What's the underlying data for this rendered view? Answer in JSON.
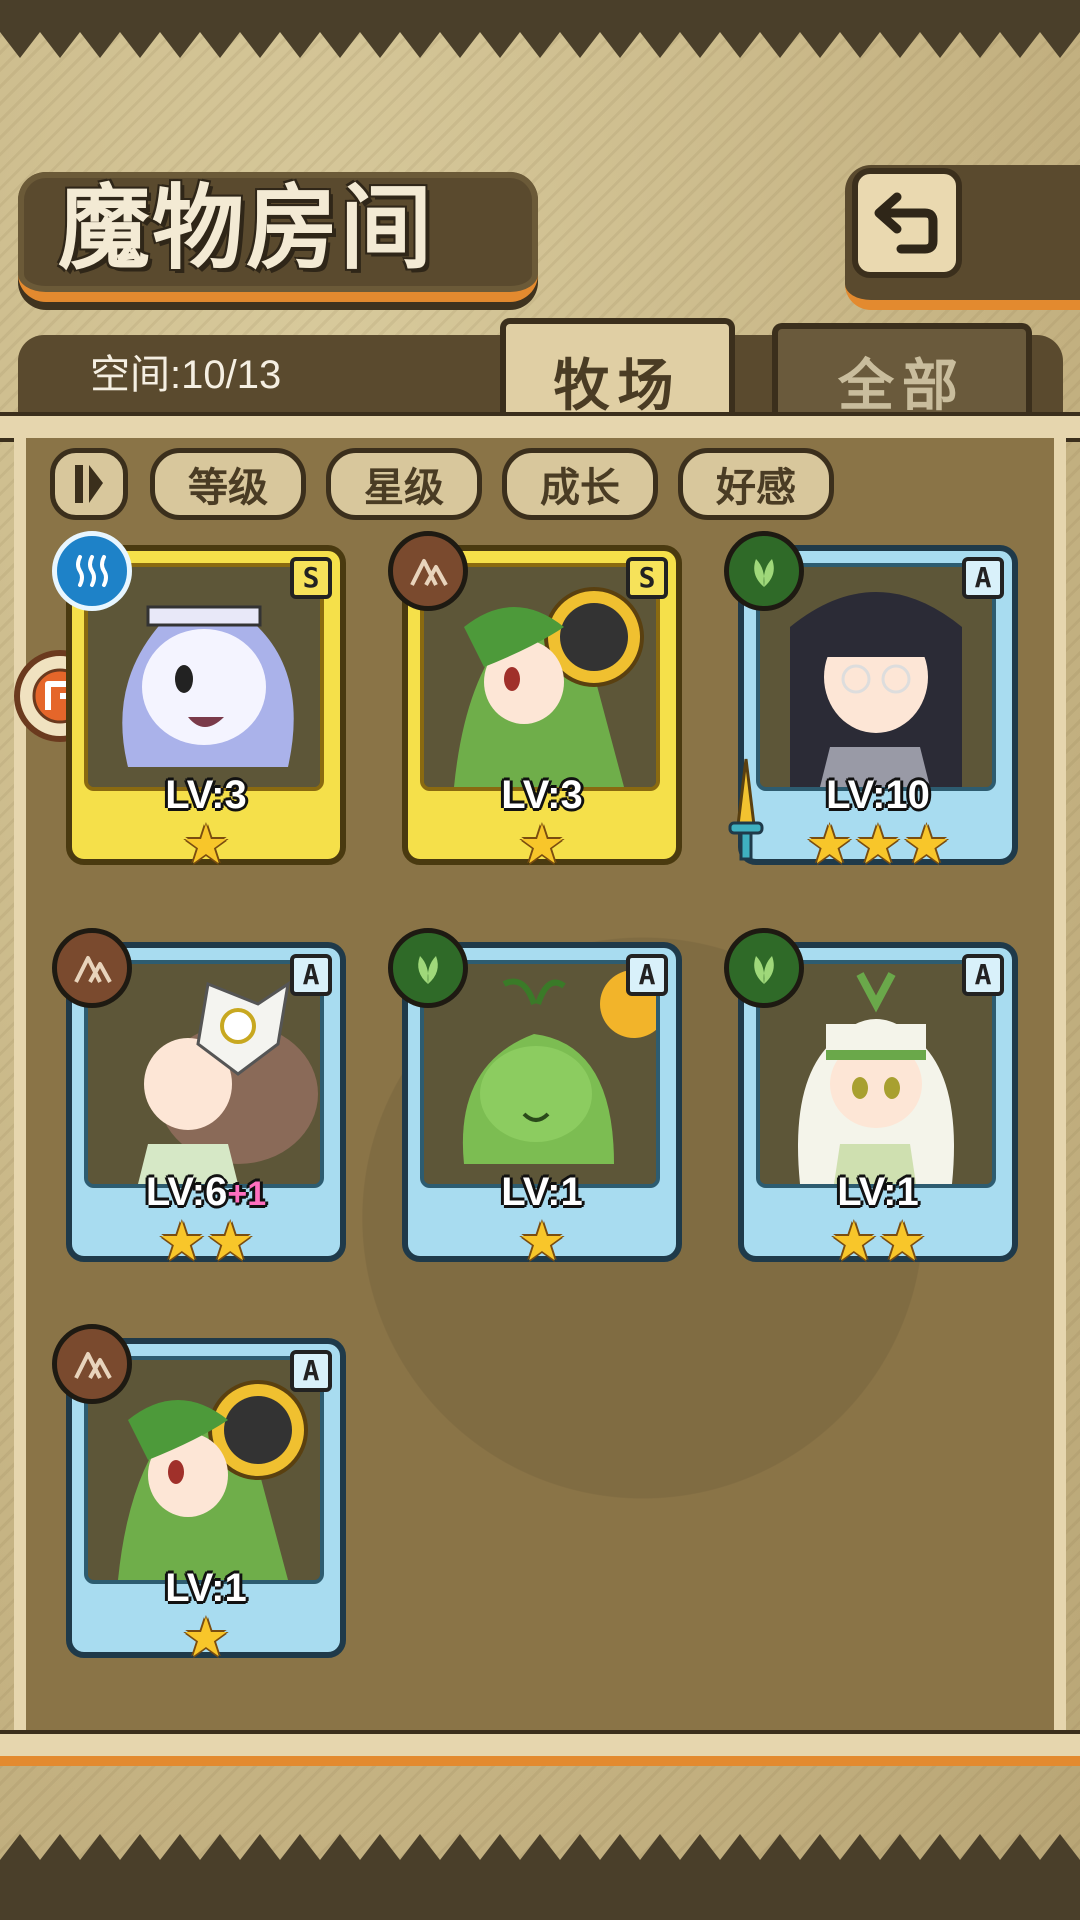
{
  "header": {
    "title": "魔物房间",
    "back_icon": "return-arrow-icon"
  },
  "panel": {
    "capacity_label": "空间:10/13",
    "tabs": [
      {
        "label": "牧场",
        "active": true
      },
      {
        "label": "全部",
        "active": false
      }
    ]
  },
  "sort_bar": {
    "toggle_icon": "sort-order-toggle-icon",
    "buttons": [
      "等级",
      "星级",
      "成长",
      "好感"
    ]
  },
  "colors": {
    "rank_S": "#f5e04a",
    "rank_A": "#a8dcf0",
    "element_water": "#1e82c8",
    "element_earth": "#7a4a2e",
    "element_plant": "#2f6a28",
    "bonus_pink": "#ff6fbf"
  },
  "monsters": [
    {
      "rank": "S",
      "element": "water",
      "level": "LV:3",
      "bonus": "",
      "stars": "★",
      "equipped_weapon": false
    },
    {
      "rank": "S",
      "element": "earth",
      "level": "LV:3",
      "bonus": "",
      "stars": "★",
      "equipped_weapon": false
    },
    {
      "rank": "A",
      "element": "plant",
      "level": "LV:10",
      "bonus": "",
      "stars": "★★★",
      "equipped_weapon": true
    },
    {
      "rank": "A",
      "element": "earth",
      "level": "LV:6",
      "bonus": "+1",
      "stars": "★★",
      "equipped_weapon": false
    },
    {
      "rank": "A",
      "element": "plant",
      "level": "LV:1",
      "bonus": "",
      "stars": "★",
      "equipped_weapon": false
    },
    {
      "rank": "A",
      "element": "plant",
      "level": "LV:1",
      "bonus": "",
      "stars": "★★",
      "equipped_weapon": false
    },
    {
      "rank": "A",
      "element": "earth",
      "level": "LV:1",
      "bonus": "",
      "stars": "★",
      "equipped_weapon": false
    }
  ]
}
